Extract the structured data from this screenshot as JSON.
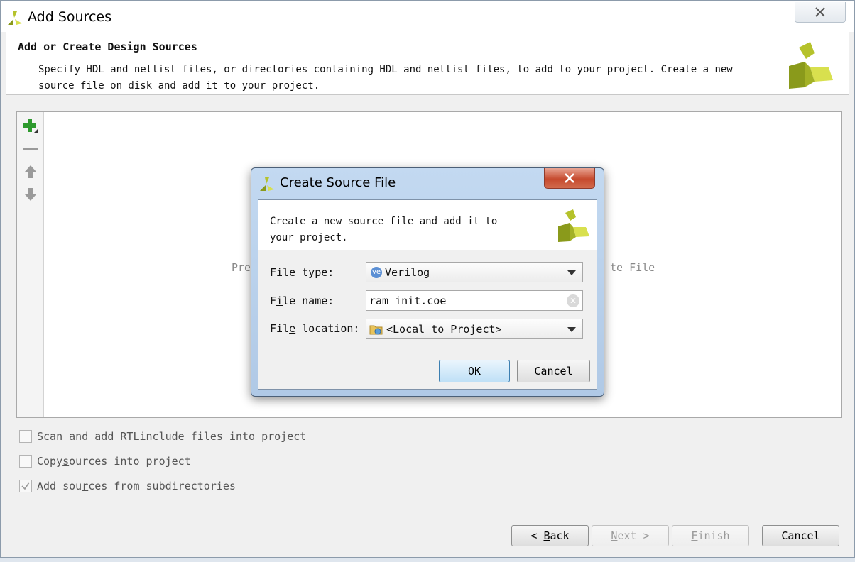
{
  "window": {
    "title": "Add Sources"
  },
  "header": {
    "title": "Add or Create Design Sources",
    "description": "Specify HDL and netlist files, or directories containing HDL and netlist files, to add to your project. Create a new source file on disk and add it to your project."
  },
  "list_panel": {
    "hint_left": "Pre",
    "hint_right": "te File"
  },
  "options": [
    {
      "pre": "Scan and add RTL ",
      "ul": "i",
      "post": "nclude files into project",
      "checked": false
    },
    {
      "pre": "Copy ",
      "ul": "s",
      "post": "ources into project",
      "checked": false
    },
    {
      "pre": "Add sou",
      "ul": "r",
      "post": "ces from subdirectories",
      "checked": true
    }
  ],
  "footer": {
    "back": {
      "arrow": "<",
      "ul": "B",
      "rest": "ack"
    },
    "next": {
      "ul": "N",
      "rest": "ext",
      "arrow": ">"
    },
    "finish": {
      "ul": "F",
      "rest": "inish"
    },
    "cancel": "Cancel"
  },
  "dialog": {
    "title": "Create Source File",
    "message": "Create a new source file and add it to your project.",
    "file_type": {
      "label_ul": "F",
      "label_rest": "ile type:",
      "value": "Verilog",
      "badge": "ve"
    },
    "file_name": {
      "label_pre": "F",
      "label_ul": "i",
      "label_rest": "le name:",
      "value": "ram_init.coe"
    },
    "file_location": {
      "label_pre": "Fil",
      "label_ul": "e",
      "label_rest": " location:",
      "value": "<Local to Project>"
    },
    "ok": "OK",
    "cancel": "Cancel"
  },
  "colors": {
    "logo_dark": "#8a9a1b",
    "logo_light": "#d8e04e",
    "add_green": "#2e9a2e",
    "dialog_frame": "#b6cde8",
    "close_red": "#c64a2e"
  },
  "icons": {
    "app": "xilinx-logo-icon",
    "add": "plus-icon",
    "remove": "minus-icon",
    "up": "arrow-up-icon",
    "down": "arrow-down-icon"
  }
}
